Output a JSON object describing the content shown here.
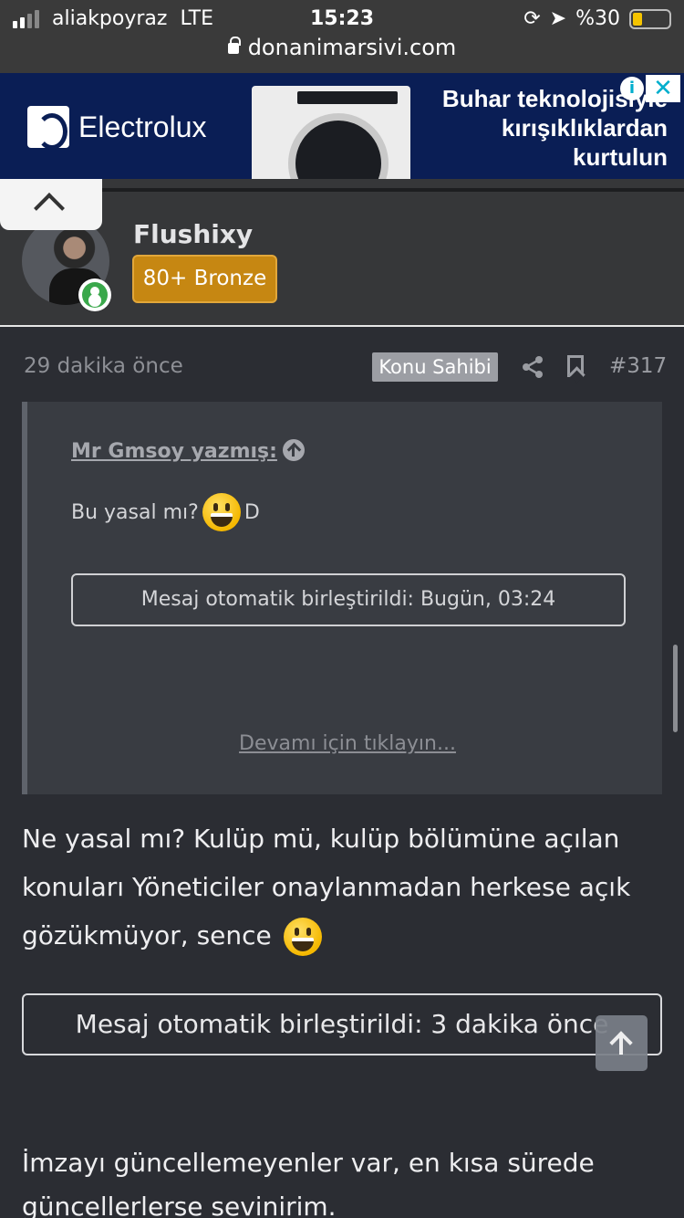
{
  "status_bar": {
    "carrier": "aliakpoyraz",
    "network": "LTE",
    "time": "15:23",
    "battery": "%30"
  },
  "browser": {
    "url": "donanimarsivi.com"
  },
  "ad": {
    "brand": "Electrolux",
    "headline_lines": [
      "Buhar teknolojisiyle",
      "kırışıklıklardan",
      "kurtulun"
    ],
    "choices_icon": "i",
    "close_icon": "✕"
  },
  "user": {
    "name": "Flushixy",
    "rank": "80+ Bronze"
  },
  "post": {
    "time": "29 dakika önce",
    "op_badge": "Konu Sahibi",
    "number": "#317",
    "quote": {
      "author": "Mr Gmsoy yazmış:",
      "text": "Bu yasal mı?",
      "text_suffix": "D",
      "merge_notice": "Mesaj otomatik birleştirildi: Bugün, 03:24",
      "expand_link": "Devamı için tıklayın..."
    },
    "body_text": "Ne yasal mı? Kulüp mü, kulüp bölümüne açılan konuları Yöneticiler onaylanmadan herkese açık gözükmüyor, sence",
    "merge_notice": "Mesaj otomatik birleştirildi: 3 dakika önce",
    "signature_text": "İmzayı güncellemeyenler var, en kısa sürede güncellerlerse sevinirim."
  },
  "colors": {
    "background": "#2b2d33",
    "rank_badge": "#c68712",
    "online": "#3aa84b",
    "ad_background": "#0a1e55"
  }
}
